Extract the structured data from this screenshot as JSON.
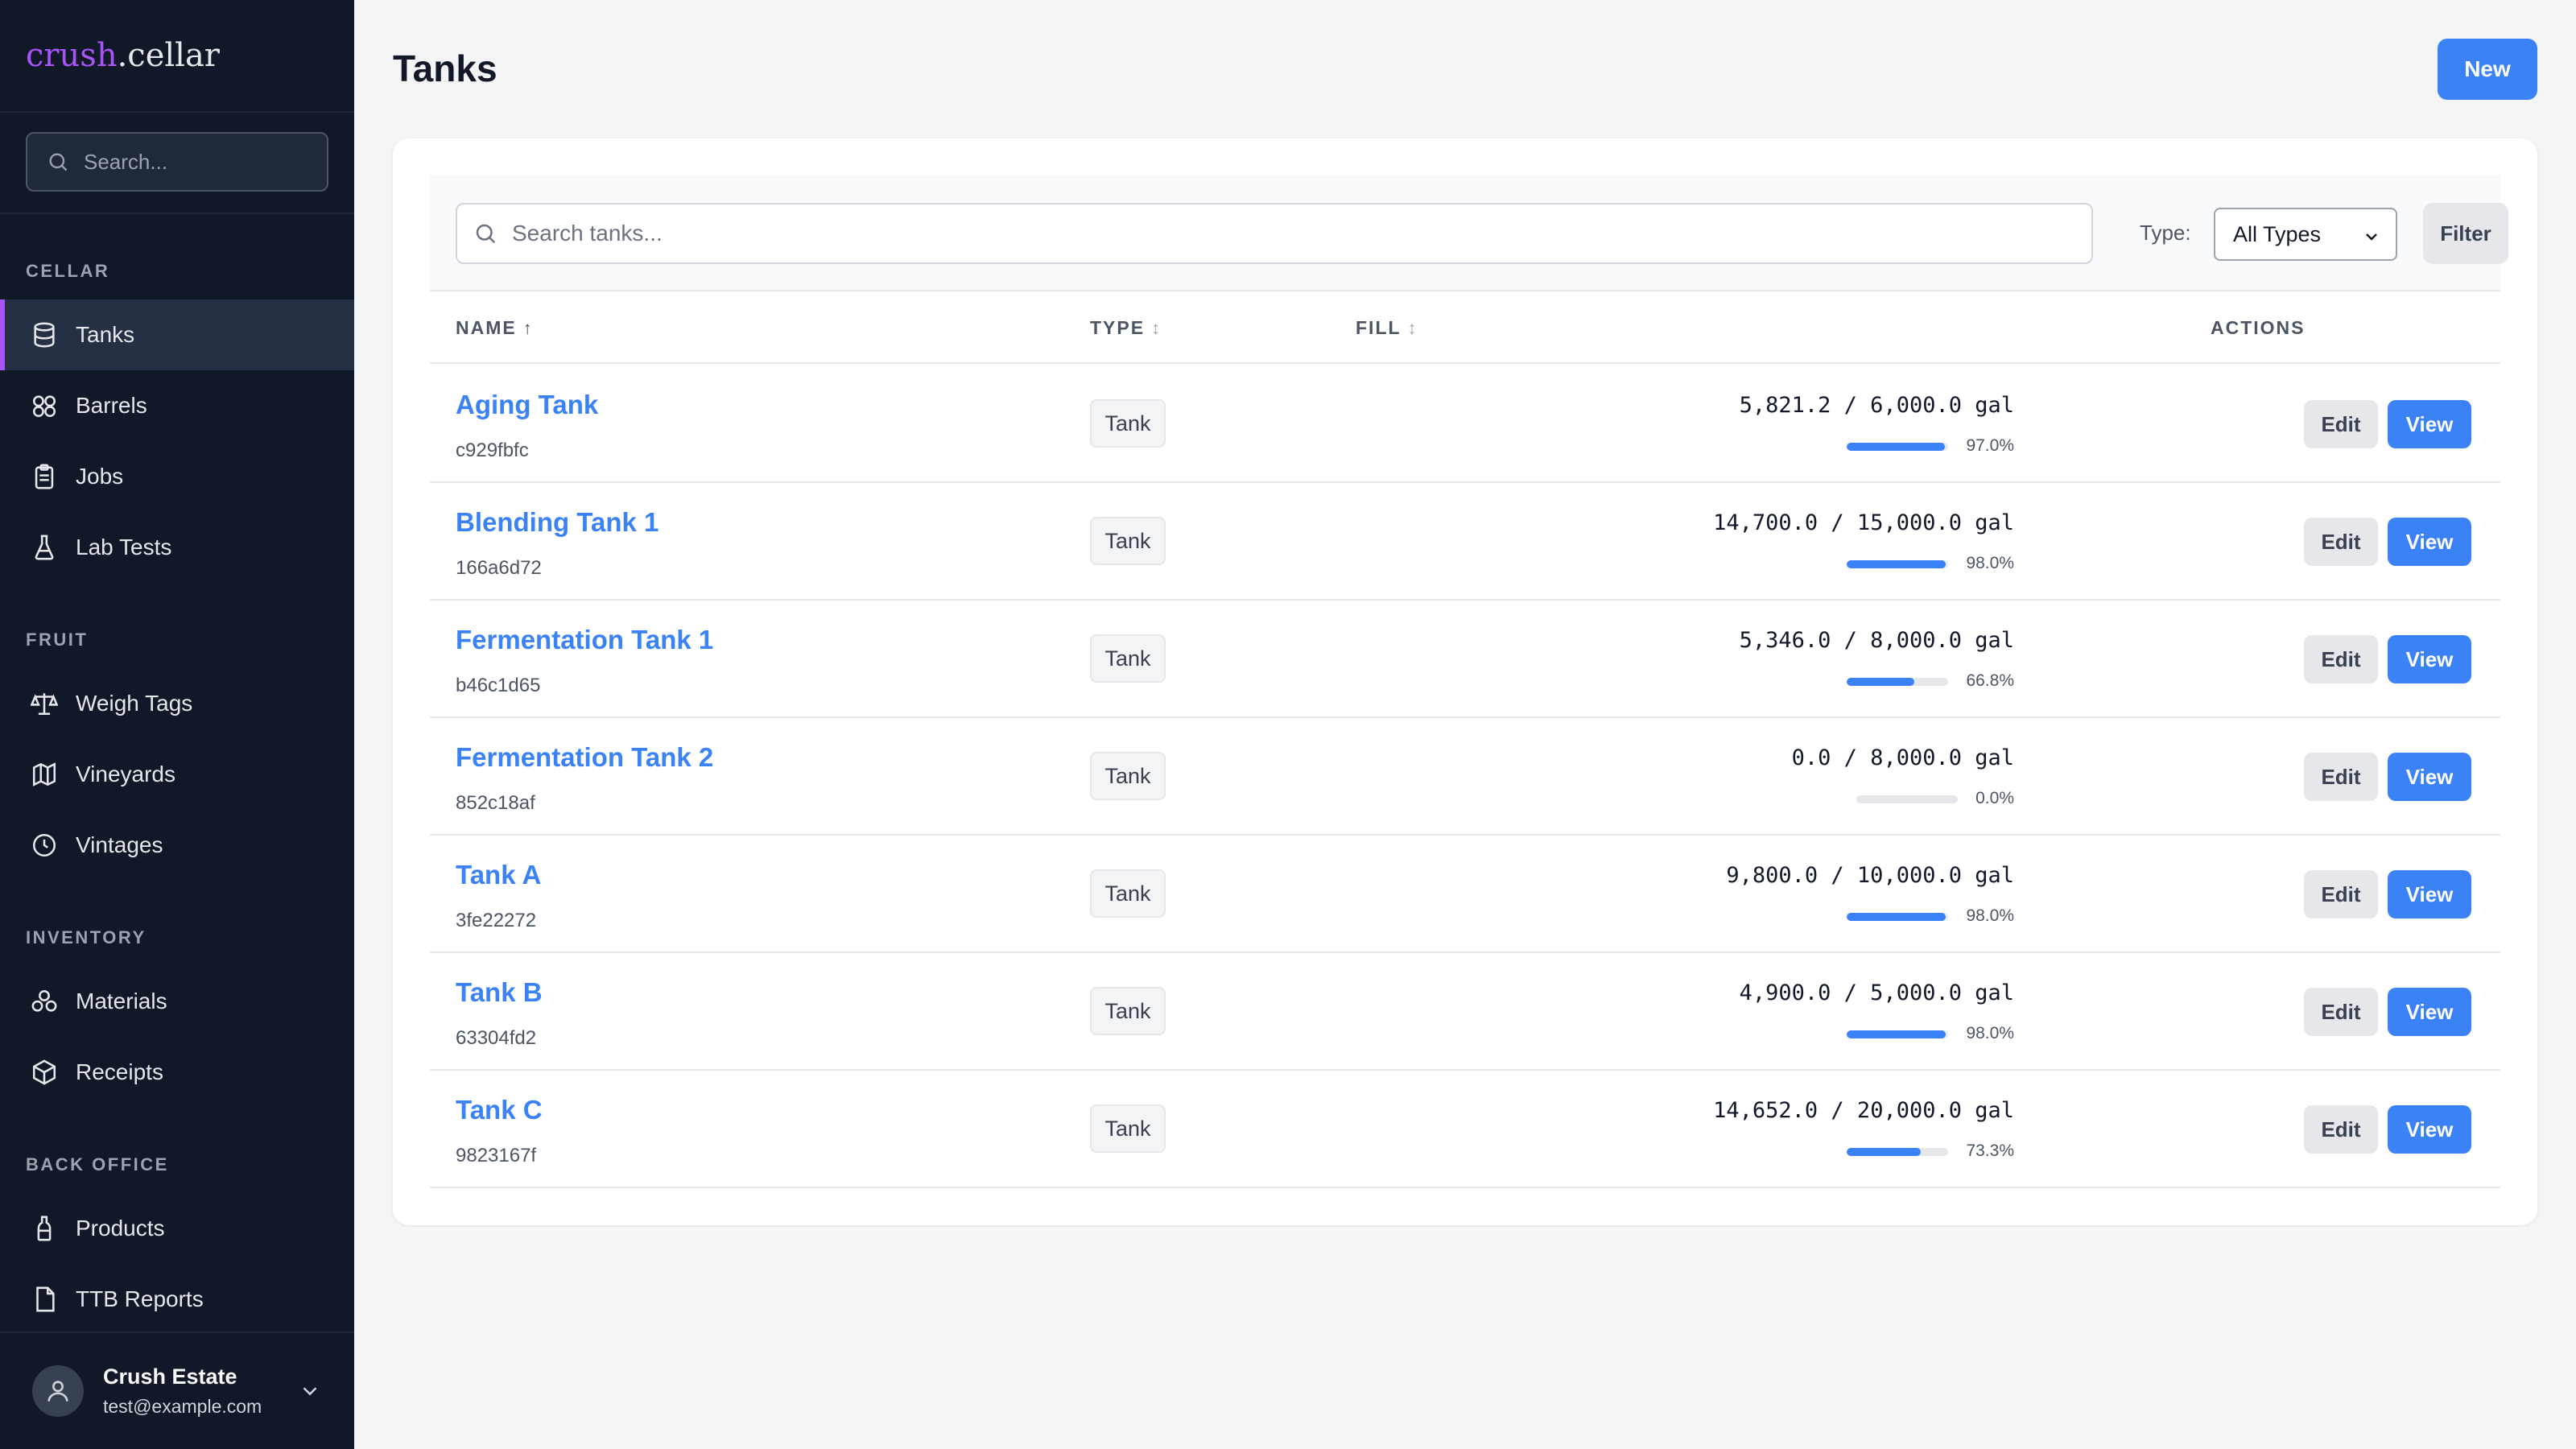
{
  "brand": {
    "part1": "crush",
    "part2": ".cellar"
  },
  "sidebar": {
    "search_placeholder": "Search...",
    "sections": {
      "cellar": "CELLAR",
      "fruit": "FRUIT",
      "inventory": "INVENTORY",
      "back_office": "BACK OFFICE"
    },
    "items": {
      "tanks": {
        "label": "Tanks",
        "icon": "database-icon",
        "active": true
      },
      "barrels": {
        "label": "Barrels",
        "icon": "barrels-icon"
      },
      "jobs": {
        "label": "Jobs",
        "icon": "clipboard-icon"
      },
      "lab_tests": {
        "label": "Lab Tests",
        "icon": "flask-icon"
      },
      "weigh_tags": {
        "label": "Weigh Tags",
        "icon": "scale-icon"
      },
      "vineyards": {
        "label": "Vineyards",
        "icon": "map-icon"
      },
      "vintages": {
        "label": "Vintages",
        "icon": "clock-icon"
      },
      "materials": {
        "label": "Materials",
        "icon": "materials-icon"
      },
      "receipts": {
        "label": "Receipts",
        "icon": "box-icon"
      },
      "products": {
        "label": "Products",
        "icon": "bottle-icon"
      },
      "ttb_reports": {
        "label": "TTB Reports",
        "icon": "report-icon"
      }
    },
    "user": {
      "name": "Crush Estate",
      "email": "test@example.com"
    }
  },
  "header": {
    "title": "Tanks",
    "new_label": "New"
  },
  "toolbar": {
    "search_placeholder": "Search tanks...",
    "type_label": "Type:",
    "type_selected": "All Types",
    "filter_label": "Filter"
  },
  "table": {
    "columns": {
      "name": "NAME",
      "name_sort": "↑",
      "type": "TYPE",
      "type_sort": "↕",
      "fill": "FILL",
      "fill_sort": "↕",
      "actions": "ACTIONS"
    },
    "edit_label": "Edit",
    "view_label": "View",
    "rows": [
      {
        "name": "Aging Tank",
        "id": "c929fbfc",
        "type": "Tank",
        "fill": "5,821.2 / 6,000.0 gal",
        "pct": "97.0%",
        "fill_fraction": 0.97
      },
      {
        "name": "Blending Tank 1",
        "id": "166a6d72",
        "type": "Tank",
        "fill": "14,700.0 / 15,000.0 gal",
        "pct": "98.0%",
        "fill_fraction": 0.98
      },
      {
        "name": "Fermentation Tank 1",
        "id": "b46c1d65",
        "type": "Tank",
        "fill": "5,346.0 / 8,000.0 gal",
        "pct": "66.8%",
        "fill_fraction": 0.668
      },
      {
        "name": "Fermentation Tank 2",
        "id": "852c18af",
        "type": "Tank",
        "fill": "0.0 / 8,000.0 gal",
        "pct": "0.0%",
        "fill_fraction": 0.0
      },
      {
        "name": "Tank A",
        "id": "3fe22272",
        "type": "Tank",
        "fill": "9,800.0 / 10,000.0 gal",
        "pct": "98.0%",
        "fill_fraction": 0.98
      },
      {
        "name": "Tank B",
        "id": "63304fd2",
        "type": "Tank",
        "fill": "4,900.0 / 5,000.0 gal",
        "pct": "98.0%",
        "fill_fraction": 0.98
      },
      {
        "name": "Tank C",
        "id": "9823167f",
        "type": "Tank",
        "fill": "14,652.0 / 20,000.0 gal",
        "pct": "73.3%",
        "fill_fraction": 0.733
      }
    ]
  },
  "colors": {
    "sidebar_bg": "#111827",
    "accent": "#3b82f6",
    "brand_accent": "#a855f7"
  }
}
